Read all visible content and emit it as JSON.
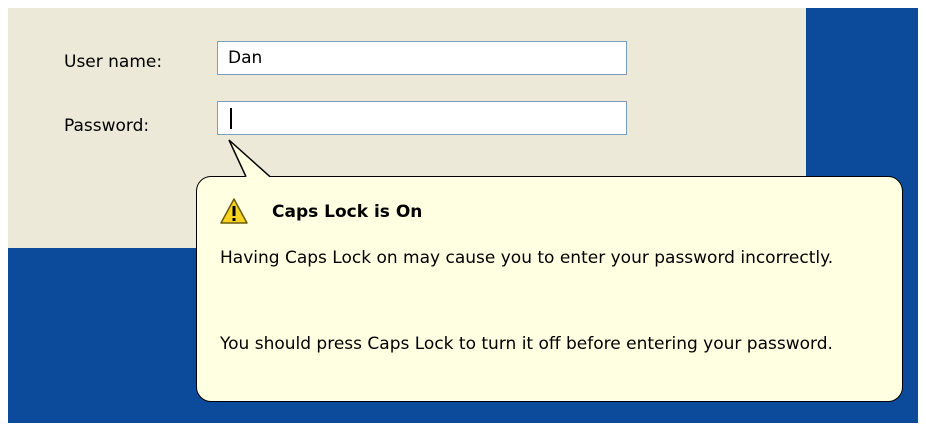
{
  "login": {
    "username_label": "User name:",
    "username_value": "Dan",
    "password_label": "Password:",
    "password_value": ""
  },
  "balloon": {
    "icon": "warning-icon",
    "title": "Caps Lock is On",
    "message_1": "Having Caps Lock on may cause you to enter your password incorrectly.",
    "message_2": "You should press Caps Lock to turn it off before entering your password."
  },
  "colors": {
    "dialog_background": "#ece9d8",
    "desktop_background": "#0c4b9c",
    "tooltip_background": "#ffffe1",
    "field_border": "#7f9db9",
    "warning_yellow": "#f7d21f"
  }
}
